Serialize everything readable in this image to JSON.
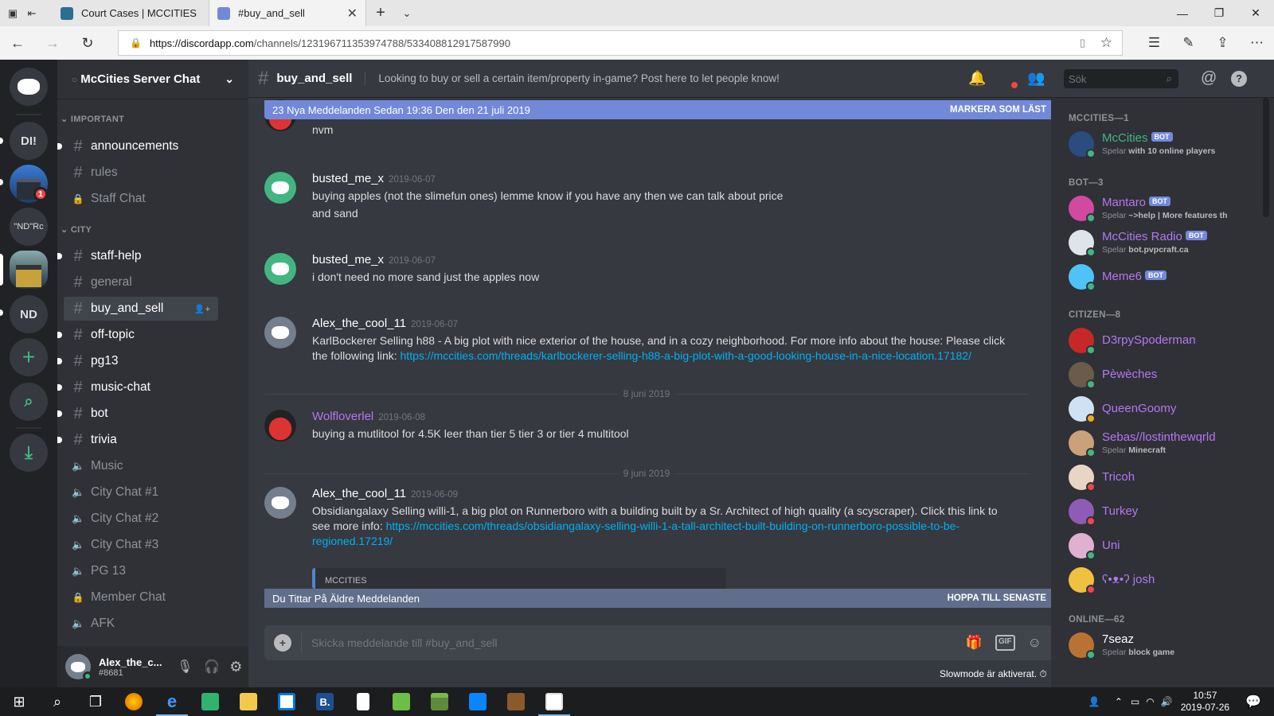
{
  "browser": {
    "tabs": [
      {
        "title": "Court Cases | MCCITIES",
        "icon": "court-favicon",
        "active": false
      },
      {
        "title": "#buy_and_sell",
        "icon": "discord-favicon",
        "active": true
      }
    ],
    "url_host": "https://discordapp.com",
    "url_path": "/channels/123196711353974788/533408812917587990"
  },
  "servers": [
    {
      "label": "DI!"
    },
    {
      "label": "\"ND\"Rc"
    },
    {
      "label": "ND"
    }
  ],
  "server_badge": "1",
  "server_name": "McCities Server Chat",
  "categories": {
    "important": "IMPORTANT",
    "city": "CITY"
  },
  "channels": [
    {
      "name": "announcements",
      "type": "text",
      "unread": true
    },
    {
      "name": "rules",
      "type": "text"
    },
    {
      "name": "Staff Chat",
      "type": "locked"
    },
    {
      "name": "staff-help",
      "type": "text",
      "unread": true
    },
    {
      "name": "general",
      "type": "text"
    },
    {
      "name": "buy_and_sell",
      "type": "text",
      "active": true
    },
    {
      "name": "off-topic",
      "type": "text",
      "unread": true
    },
    {
      "name": "pg13",
      "type": "text",
      "unread": true
    },
    {
      "name": "music-chat",
      "type": "text",
      "unread": true
    },
    {
      "name": "bot",
      "type": "text",
      "unread": true
    },
    {
      "name": "trivia",
      "type": "text",
      "unread": true
    },
    {
      "name": "Music",
      "type": "voice"
    },
    {
      "name": "City Chat #1",
      "type": "voice"
    },
    {
      "name": "City Chat #2",
      "type": "voice"
    },
    {
      "name": "City Chat #3",
      "type": "voice"
    },
    {
      "name": "PG 13",
      "type": "voice"
    },
    {
      "name": "Member Chat",
      "type": "locked"
    },
    {
      "name": "AFK",
      "type": "voice"
    }
  ],
  "user": {
    "name": "Alex_the_c...",
    "tag": "#8681"
  },
  "chat": {
    "channel": "buy_and_sell",
    "topic": "Looking to buy or sell a certain item/property in-game? Post here to let people know!",
    "search_placeholder": "Sök",
    "new_messages": "23 Nya Meddelanden Sedan 19:36 Den den 21 juli 2019",
    "mark_read": "MARKERA SOM LÄST",
    "older": "Du Tittar På Äldre Meddelanden",
    "jump": "HOPPA TILL SENASTE",
    "composer_placeholder": "Skicka meddelande till #buy_and_sell",
    "slowmode": "Slowmode är aktiverat.",
    "dividers": [
      "8 juni 2019",
      "9 juni 2019"
    ],
    "messages": [
      {
        "author": "Wolfloverlel",
        "time": "2019-06-07",
        "color": "#b377f3",
        "lines": [
          "nvm"
        ]
      },
      {
        "author": "busted_me_x",
        "time": "2019-06-07",
        "color": "#ffffff",
        "lines": [
          "buying apples (not the slimefun ones) lemme know if you have any then we can talk about price",
          "and sand"
        ]
      },
      {
        "author": "busted_me_x",
        "time": "2019-06-07",
        "color": "#ffffff",
        "lines": [
          "i don't need no more sand just the apples now"
        ]
      },
      {
        "author": "Alex_the_cool_11",
        "time": "2019-06-07",
        "color": "#ffffff",
        "lines": [
          "KarlBockerer Selling h88 - A big plot with nice exterior of the house, and in a cozy neighborhood. For more info about the house: Please click",
          "the following link: "
        ],
        "link": "https://mccities.com/threads/karlbockerer-selling-h88-a-big-plot-with-a-good-looking-house-in-a-nice-location.17182/"
      },
      {
        "author": "Wolfloverlel",
        "time": "2019-06-08",
        "color": "#b377f3",
        "lines": [
          "buying a mutlitool for 4.5K leer than tier 5 tier 3 or tier 4 multitool"
        ]
      },
      {
        "author": "Alex_the_cool_11",
        "time": "2019-06-09",
        "color": "#ffffff",
        "lines": [
          "Obsidiangalaxy Selling willi-1, a big plot on Runnerboro with a building built by a Sr. Architect of high quality (a scyscraper). Click this link to",
          "see more info: "
        ],
        "link": "https://mccities.com/threads/obsidiangalaxy-selling-willi-1-a-tall-architect-built-building-on-runnerboro-possible-to-be-",
        "link2": "regioned.17219/",
        "embed_site": "MCCITIES"
      }
    ]
  },
  "members": {
    "groups": [
      "MCCITIES—1",
      "BOT—3",
      "CITIZEN—8",
      "ONLINE—62"
    ],
    "list": [
      {
        "name": "McCities",
        "bot": true,
        "color": "#43b581",
        "sub_prefix": "Spelar",
        "sub": "with 10 online players"
      },
      {
        "name": "Mantaro",
        "bot": true,
        "color": "#b377f3",
        "sub_prefix": "Spelar",
        "sub": "~>help | More features th"
      },
      {
        "name": "McCities Radio",
        "bot": true,
        "color": "#b377f3",
        "sub_prefix": "Spelar",
        "sub": "bot.pvpcraft.ca"
      },
      {
        "name": "Meme6",
        "bot": true,
        "color": "#b377f3",
        "sub_prefix": "",
        "sub": ""
      },
      {
        "name": "D3rpySpoderman",
        "color": "#b377f3"
      },
      {
        "name": "Pèwèches",
        "color": "#b377f3"
      },
      {
        "name": "QueenGoomy",
        "color": "#b377f3"
      },
      {
        "name": "Sebas//lostinthewqrld",
        "color": "#b377f3",
        "sub_prefix": "Spelar",
        "sub": "Minecraft"
      },
      {
        "name": "Tricoh",
        "color": "#b377f3"
      },
      {
        "name": "Turkey",
        "color": "#b377f3"
      },
      {
        "name": "Uni",
        "color": "#b377f3"
      },
      {
        "name": "ʕ•ᴥ•ʔ josh",
        "color": "#b377f3"
      },
      {
        "name": "7seaz",
        "color": "#ffffff",
        "sub_prefix": "Spelar",
        "sub": "block game"
      }
    ],
    "bot_tag": "BOT"
  },
  "taskbar": {
    "time": "10:57",
    "date": "2019-07-26"
  }
}
